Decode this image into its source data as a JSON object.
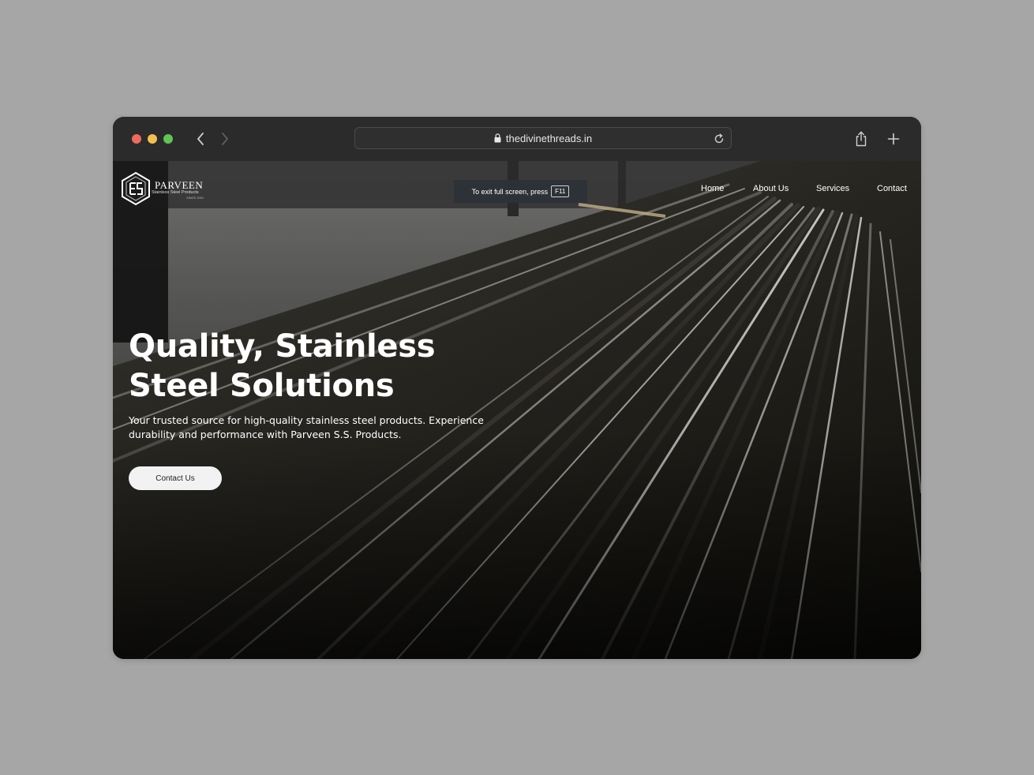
{
  "browser": {
    "url": "thedivinethreads.in",
    "colors": {
      "close": "#ed6a5e",
      "minimize": "#f5bf4f",
      "zoom": "#61c554",
      "chrome": "#2b2b2b"
    }
  },
  "site": {
    "logo": {
      "name": "PARVEEN",
      "subtitle": "Stainless Steel Products",
      "tagline": "SINCE 2001"
    },
    "fullscreen_notice": {
      "text": "To exit full screen, press",
      "key": "F11"
    },
    "nav": [
      "Home",
      "About Us",
      "Services",
      "Contact"
    ],
    "hero": {
      "title_line1": "Quality, Stainless",
      "title_line2": "Steel Solutions",
      "subtitle": "Your trusted source for high-quality stainless steel products. Experience durability and performance with Parveen S.S. Products.",
      "cta_label": "Contact Us"
    }
  }
}
